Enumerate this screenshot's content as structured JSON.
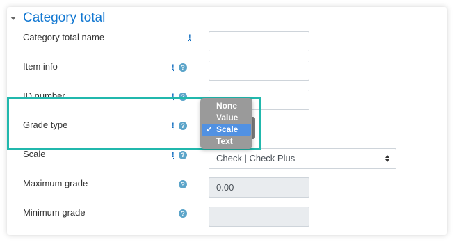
{
  "section": {
    "title": "Category total"
  },
  "fields": [
    {
      "label": "Category total name",
      "value": ""
    },
    {
      "label": "Item info",
      "value": ""
    },
    {
      "label": "ID number",
      "value": ""
    },
    {
      "label": "Grade type"
    },
    {
      "label": "Scale",
      "value": "Check | Check Plus"
    },
    {
      "label": "Maximum grade",
      "value": "0.00"
    },
    {
      "label": "Minimum grade",
      "value": ""
    }
  ],
  "grade_type_options": [
    "None",
    "Value",
    "Scale",
    "Text"
  ],
  "grade_type_selected": "Scale",
  "req_marker": "!",
  "help_marker": "?",
  "check_mark": "✓",
  "colors": {
    "accent": "#1177d1",
    "highlight_border": "#21b8ad",
    "menu_bg": "#9a9a9a",
    "menu_selected": "#5191e2"
  }
}
